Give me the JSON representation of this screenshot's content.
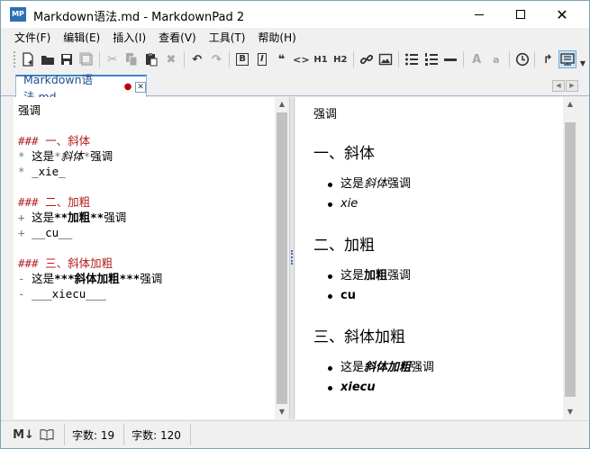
{
  "window": {
    "title": "Markdown语法.md - MarkdownPad 2",
    "app_icon_text": "MP",
    "min_glyph": "",
    "close_glyph": "✕"
  },
  "menu": [
    "文件(F)",
    "编辑(E)",
    "插入(I)",
    "查看(V)",
    "工具(T)",
    "帮助(H)"
  ],
  "toolbar": {
    "bold": "B",
    "italic": "I",
    "quote": "❝",
    "code": "<>",
    "h1": "H1",
    "h2": "H2",
    "font_large": "A",
    "font_small": "a"
  },
  "tab": {
    "label": "Markdown语法.md",
    "modified_marker": "●",
    "close": "✕"
  },
  "editor": {
    "lines": [
      {
        "parts": [
          {
            "t": "强调",
            "c": ""
          }
        ]
      },
      {
        "parts": []
      },
      {
        "parts": [
          {
            "t": "### 一、斜体",
            "c": "h"
          }
        ]
      },
      {
        "parts": [
          {
            "t": "* ",
            "c": "m"
          },
          {
            "t": "这是",
            "c": ""
          },
          {
            "t": "*",
            "c": "m"
          },
          {
            "t": "斜体",
            "c": "i"
          },
          {
            "t": "*",
            "c": "m"
          },
          {
            "t": "强调",
            "c": ""
          }
        ]
      },
      {
        "parts": [
          {
            "t": "* ",
            "c": "m"
          },
          {
            "t": "_xie_",
            "c": ""
          }
        ]
      },
      {
        "parts": []
      },
      {
        "parts": [
          {
            "t": "### 二、加粗",
            "c": "h"
          }
        ]
      },
      {
        "parts": [
          {
            "t": "+ ",
            "c": "m"
          },
          {
            "t": "这是",
            "c": ""
          },
          {
            "t": "**",
            "c": "b"
          },
          {
            "t": "加粗",
            "c": "b"
          },
          {
            "t": "**",
            "c": "b"
          },
          {
            "t": "强调",
            "c": ""
          }
        ]
      },
      {
        "parts": [
          {
            "t": "+ ",
            "c": "m"
          },
          {
            "t": "__cu__",
            "c": ""
          }
        ]
      },
      {
        "parts": []
      },
      {
        "parts": [
          {
            "t": "### 三、斜体加粗",
            "c": "h"
          }
        ]
      },
      {
        "parts": [
          {
            "t": "- ",
            "c": "m"
          },
          {
            "t": "这是",
            "c": ""
          },
          {
            "t": "***",
            "c": "b"
          },
          {
            "t": "斜体加粗",
            "c": "b"
          },
          {
            "t": "***",
            "c": "b"
          },
          {
            "t": "强调",
            "c": ""
          }
        ]
      },
      {
        "parts": [
          {
            "t": "- ",
            "c": "m"
          },
          {
            "t": "___xiecu___",
            "c": ""
          }
        ]
      }
    ]
  },
  "preview": {
    "title": "强调",
    "sections": [
      {
        "heading": "一、斜体",
        "items": [
          [
            {
              "t": "这是",
              "c": ""
            },
            {
              "t": "斜体",
              "c": "i"
            },
            {
              "t": "强调",
              "c": ""
            }
          ],
          [
            {
              "t": "xie",
              "c": "i"
            }
          ]
        ]
      },
      {
        "heading": "二、加粗",
        "items": [
          [
            {
              "t": "这是",
              "c": ""
            },
            {
              "t": "加粗",
              "c": "b"
            },
            {
              "t": "强调",
              "c": ""
            }
          ],
          [
            {
              "t": "cu",
              "c": "b"
            }
          ]
        ]
      },
      {
        "heading": "三、斜体加粗",
        "items": [
          [
            {
              "t": "这是",
              "c": ""
            },
            {
              "t": "斜体加粗",
              "c": "b i"
            },
            {
              "t": "强调",
              "c": ""
            }
          ],
          [
            {
              "t": "xiecu",
              "c": "b i"
            }
          ]
        ]
      }
    ]
  },
  "status": {
    "word_count": "字数: 19",
    "char_count": "字数:  120"
  },
  "colors": {
    "heading_md": "#b31d1d",
    "tab_accent": "#3b83c7",
    "app_icon": "#2d6fb4"
  }
}
